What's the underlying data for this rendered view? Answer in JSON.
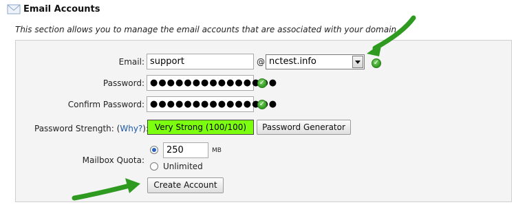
{
  "section": {
    "title": "Email Accounts",
    "description": "This section allows you to manage the email accounts that are associated with your domain."
  },
  "form": {
    "email_label": "Email:",
    "email_value": "support",
    "at_sign": "@",
    "domain_value": "nctest.info",
    "password_label": "Password:",
    "password_value": "●●●●●●●●●●●●●●●",
    "confirm_label": "Confirm Password:",
    "confirm_value": "●●●●●●●●●●●●●●●",
    "strength_label": "Password Strength:",
    "strength_why_open": "(",
    "strength_why": "Why?",
    "strength_why_close": "):",
    "strength_value": "Very Strong (100/100)",
    "generator_button": "Password Generator",
    "quota_label": "Mailbox Quota:",
    "quota_value": "250",
    "quota_unit": "MB",
    "quota_unlimited": "Unlimited",
    "create_button": "Create Account"
  },
  "colors": {
    "strength_bg": "#7dff10",
    "arrow": "#2e9a1f"
  }
}
